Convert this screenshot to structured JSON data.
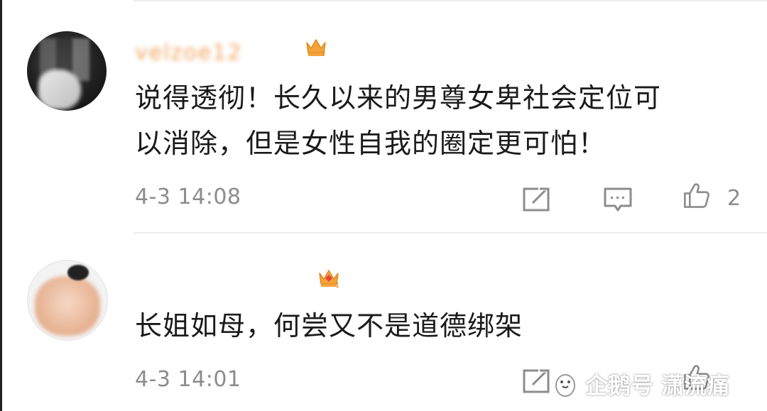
{
  "comments": [
    {
      "username": "velzoe12",
      "badge_icon": "crown-icon",
      "text_line1": "说得透彻！长久以来的男尊女卑社会定位可",
      "text_line2": "以消除，但是女性自我的圈定更可怕！",
      "time": "4-3 14:08",
      "like_count": "2"
    },
    {
      "username": "",
      "badge_icon": "crown-icon",
      "text_line1": "长姐如母，何尝又不是道德绑架",
      "time": "4-3 14:01"
    }
  ],
  "watermark": {
    "text": "企鹅号 潇流痛"
  },
  "colors": {
    "username": "#f0a35a",
    "crown": "#f2a43a",
    "icon": "#8c8c8c",
    "time": "#8c8c8c",
    "divider": "#ededed"
  }
}
